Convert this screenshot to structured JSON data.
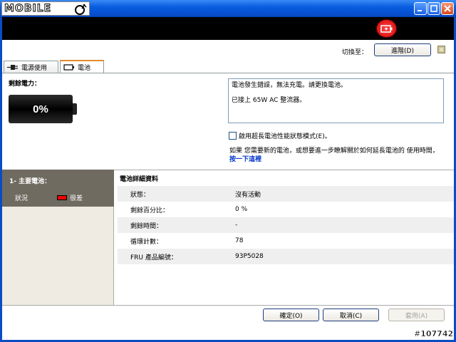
{
  "window": {
    "logo_text": "MOBILE",
    "buttons": [
      "minimize",
      "maximize",
      "close"
    ]
  },
  "header": {
    "alert_icon": "battery-alert-icon",
    "switch_label": "切換至：",
    "advanced_button": "進階(D)"
  },
  "tabs": [
    {
      "label": "電源使用",
      "icon": "plug-icon"
    },
    {
      "label": "電池",
      "icon": "battery-icon",
      "active": true
    }
  ],
  "battery": {
    "remain_label": "剩餘電力：",
    "percent_text": "0%"
  },
  "message": {
    "line1": "電池發生錯誤，無法充電。請更換電池。",
    "line2": "已接上 65W AC 整流器。"
  },
  "option": {
    "checkbox_label": "啟用超長電池性能狀態模式(E)。"
  },
  "info": {
    "text": "如果 您需要新的電池，或想要進一步瞭解關於如何延長電池的 使用時間，",
    "link": "按一下這裡"
  },
  "left_panel": {
    "title": "1- 主要電池：",
    "status_label": "狀況",
    "status_value": "很差"
  },
  "details": {
    "title": "電池詳細資料",
    "rows": [
      {
        "key": "狀態：",
        "value": "沒有活動"
      },
      {
        "key": "剩餘百分比：",
        "value": "0 %"
      },
      {
        "key": "剩餘時間：",
        "value": "-"
      },
      {
        "key": "循環計數：",
        "value": "78"
      },
      {
        "key": "FRU 產品編號：",
        "value": "93P5028"
      }
    ]
  },
  "footer": {
    "ok": "確定(O)",
    "cancel": "取消(C)",
    "apply": "套用(A)"
  },
  "watermark": "#107742",
  "colors": {
    "titlebar": "#0553d8",
    "alert_red": "#e00000",
    "left_header": "#706b61",
    "link": "#0033cc"
  }
}
